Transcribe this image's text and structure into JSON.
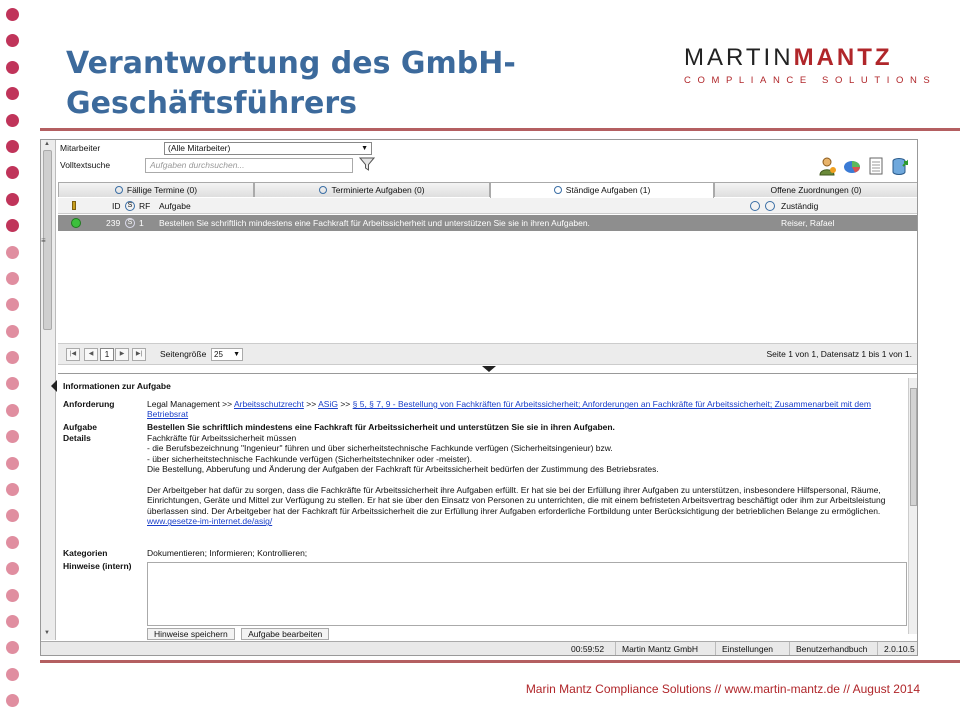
{
  "slide": {
    "title": "Verantwortung des GmbH-Geschäftsführers",
    "logo": {
      "word1": "MARTIN",
      "word2": "MANTZ",
      "sub": "COMPLIANCE SOLUTIONS"
    },
    "footer": "Marin Mantz Compliance Solutions // www.martin-mantz.de // August 2014",
    "dot_colors": [
      "#c0345a",
      "#c0345a",
      "#c0345a",
      "#c0345a",
      "#c0345a",
      "#c0345a",
      "#c0345a",
      "#c0345a",
      "#c0345a",
      "#e08ea0",
      "#e08ea0",
      "#e08ea0",
      "#e08ea0",
      "#e08ea0",
      "#e08ea0",
      "#e08ea0",
      "#e08ea0",
      "#e08ea0",
      "#e08ea0",
      "#e08ea0",
      "#e08ea0",
      "#e08ea0",
      "#e08ea0",
      "#e08ea0",
      "#e08ea0",
      "#e08ea0",
      "#e08ea0"
    ]
  },
  "app": {
    "filters": {
      "employee_label": "Mitarbeiter",
      "employee_value": "(Alle Mitarbeiter)",
      "fulltext_label": "Volltextsuche",
      "search_placeholder": "Aufgaben durchsuchen..."
    },
    "tabs": [
      {
        "label": "Fällige Termine (0)"
      },
      {
        "label": "Terminierte Aufgaben (0)"
      },
      {
        "label": "Ständige Aufgaben (1)",
        "active": true
      },
      {
        "label": "Offene Zuordnungen (0)"
      }
    ],
    "grid": {
      "headers": {
        "id": "ID",
        "rf": "RF",
        "task": "Aufgabe",
        "responsible": "Zuständig"
      },
      "rows": [
        {
          "id": "239",
          "rf": "1",
          "task": "Bestellen Sie schriftlich mindestens eine Fachkraft für Arbeitssicherheit und unterstützen Sie sie in ihren Aufgaben.",
          "responsible": "Reiser, Rafael"
        }
      ]
    },
    "pager": {
      "page": "1",
      "page_size_label": "Seitengröße",
      "page_size": "25",
      "info": "Seite 1 von 1, Datensatz 1 bis 1 von 1."
    },
    "details": {
      "title": "Informationen zur Aufgabe",
      "requirement_label": "Anforderung",
      "requirement_prefix": "Legal Management  >>",
      "requirement_link1": "Arbeitsschutzrecht",
      "sep1": ">>",
      "requirement_link2": "ASiG",
      "sep2": ">>",
      "requirement_link3": "§ 5, § 7, 9 - Bestellung von Fachkräften für Arbeitssicherheit; Anforderungen an Fachkräfte für Arbeitssicherheit; Zusammenarbeit mit dem Betriebsrat",
      "task_label": "Aufgabe",
      "task_text": "Bestellen Sie schriftlich mindestens eine Fachkraft für Arbeitssicherheit und unterstützen Sie sie in ihren Aufgaben.",
      "details_label": "Details",
      "details_lines": [
        "Fachkräfte für Arbeitssicherheit müssen",
        "- die Berufsbezeichnung \"Ingenieur\" führen und über sicherheitstechnische Fachkunde verfügen (Sicherheitsingenieur) bzw.",
        "- über sicherheitstechnische Fachkunde verfügen (Sicherheitstechniker oder -meister).",
        "Die Bestellung, Abberufung und Änderung der Aufgaben der Fachkraft für Arbeitssicherheit bedürfen der Zustimmung des Betriebsrates."
      ],
      "details_paragraph": "Der Arbeitgeber hat dafür zu sorgen, dass die Fachkräfte für Arbeitssicherheit ihre Aufgaben erfüllt. Er hat sie bei der Erfüllung ihrer Aufgaben zu unterstützen, insbesondere Hilfspersonal, Räume, Einrichtungen, Geräte und Mittel zur Verfügung zu stellen. Er hat sie über den Einsatz von Personen zu unterrichten, die mit einem befristeten Arbeitsvertrag beschäftigt oder ihm zur Arbeitsleistung überlassen sind. Der Arbeitgeber hat der Fachkraft für Arbeitssicherheit die zur Erfüllung ihrer Aufgaben erforderliche Fortbildung unter Berücksichtigung der betrieblichen Belange zu ermöglichen.",
      "details_link": "www.gesetze-im-internet.de/asig/",
      "categories_label": "Kategorien",
      "categories_value": "Dokumentieren; Informieren; Kontrollieren;",
      "notes_label": "Hinweise (intern)",
      "save_button": "Hinweise speichern",
      "edit_button": "Aufgabe bearbeiten"
    },
    "status": {
      "time": "00:59:52",
      "company": "Martin Mantz GmbH",
      "settings": "Einstellungen",
      "manual": "Benutzerhandbuch",
      "version": "2.0.10.5"
    }
  }
}
